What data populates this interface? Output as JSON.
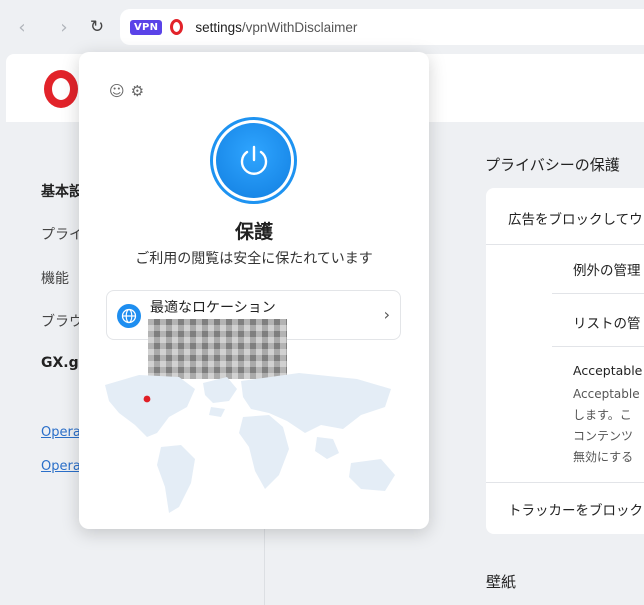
{
  "browser": {
    "url_host": "settings",
    "url_path": "/vpnWithDisclaimer",
    "vpn_badge": "VPN"
  },
  "sidebar": {
    "items": [
      {
        "label": "基本設",
        "bold": true
      },
      {
        "label": "プライ",
        "bold": false
      },
      {
        "label": "機能",
        "bold": false
      },
      {
        "label": "ブラウ",
        "bold": false
      },
      {
        "label": "GX.ga",
        "bold": true
      }
    ],
    "links": [
      "Opera",
      "Opera"
    ]
  },
  "main": {
    "section_title": "プライバシーの保護",
    "card": {
      "block_ads": "広告をブロックしてウ",
      "manage_exceptions": "例外の管理",
      "manage_lists": "リストの管",
      "acceptable_title": "Acceptable",
      "acceptable_lines": [
        "Acceptable",
        "します。こ",
        "コンテンツ",
        "無効にする"
      ],
      "block_trackers": "トラッカーをブロック"
    },
    "wallpaper_title": "壁紙"
  },
  "vpn_popup": {
    "status": "保護",
    "description": "ご利用の閲覧は安全に保たれています",
    "location_label": "最適なロケーション",
    "accent_color": "#1e93f1",
    "marker_color": "#e01f26"
  }
}
